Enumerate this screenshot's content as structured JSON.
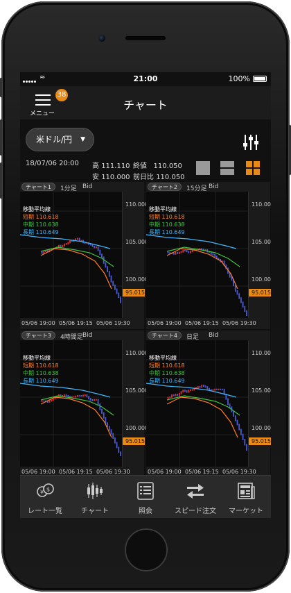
{
  "status": {
    "time": "21:00",
    "battery": "100%"
  },
  "header": {
    "menu_label": "メニュー",
    "badge": "38",
    "title": "チャート"
  },
  "toolbar": {
    "pair": "米ドル/円"
  },
  "quote": {
    "datetime": "18/07/06 20:00",
    "high_label": "高",
    "high": "111.110",
    "low_label": "安",
    "low": "110.000",
    "close_label": "終値",
    "close": "110.050",
    "prev_label": "前日比",
    "prev": "110.050"
  },
  "charts": [
    {
      "tag": "チャート1",
      "timeframe": "1分足",
      "side": "Bid"
    },
    {
      "tag": "チャート2",
      "timeframe": "15分足",
      "side": "Bid"
    },
    {
      "tag": "チャート3",
      "timeframe": "4時間足",
      "side": "Bid"
    },
    {
      "tag": "チャート4",
      "timeframe": "日足",
      "side": "Bid"
    }
  ],
  "chart_legend": {
    "title": "移動平均線",
    "short": "短期 110.618",
    "mid": "中期 110.638",
    "long": "長期 110.649"
  },
  "chart_axis": {
    "y_ticks": [
      "110.000",
      "105.000",
      "100.000"
    ],
    "current": "95.015",
    "x_ticks": [
      "05/06 19:00",
      "05/06 19:15",
      "05/06 19:30"
    ]
  },
  "colors": {
    "accent": "#e98a17",
    "short": "#ff7f27",
    "mid": "#3ec43e",
    "long": "#3fb7ff",
    "up": "#e03030",
    "down": "#4a5bd8"
  },
  "tabs": [
    {
      "label": "レート一覧",
      "icon": "rate-list-icon"
    },
    {
      "label": "チャート",
      "icon": "candlestick-chart-icon"
    },
    {
      "label": "照会",
      "icon": "inquiry-list-icon"
    },
    {
      "label": "スピード注文",
      "icon": "speed-order-icon"
    },
    {
      "label": "マーケット",
      "icon": "market-news-icon"
    }
  ]
}
